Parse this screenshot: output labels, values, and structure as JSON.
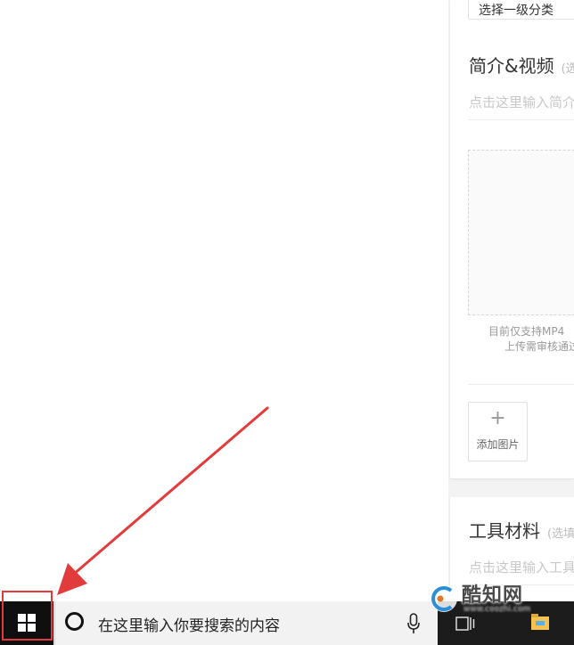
{
  "editor": {
    "category_select": {
      "value": "选择一级分类"
    },
    "intro_section": {
      "title": "简介&视频",
      "hint": "(选",
      "input_placeholder": "点击这里输入简介",
      "video_note_line1": "目前仅支持MP4",
      "video_note_line2": "上传需审核通过"
    },
    "add_image": {
      "icon": "plus-icon",
      "label": "添加图片"
    },
    "tools_section": {
      "title": "工具材料",
      "hint": "(选填",
      "input_placeholder": "点击这里输入工具"
    }
  },
  "taskbar": {
    "start_icon": "windows-logo-icon",
    "search_placeholder": "在这里输入你要搜索的内容",
    "cortana_icon": "cortana-circle-icon",
    "mic_icon": "microphone-icon",
    "task_view_icon": "task-view-icon",
    "explorer_icon": "folder-icon"
  },
  "watermark": {
    "name": "酷知网",
    "url": "www.coozhi.com"
  },
  "annotation": {
    "highlight_color": "#e23b3b"
  }
}
